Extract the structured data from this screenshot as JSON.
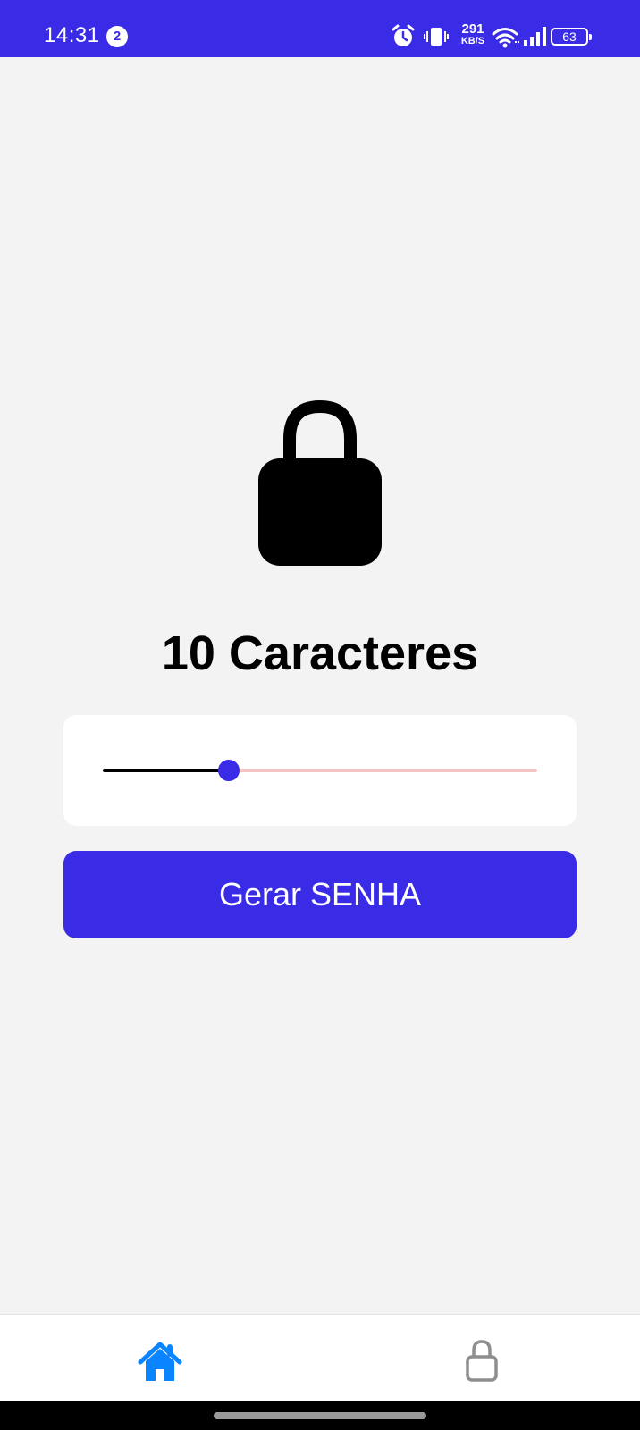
{
  "status_bar": {
    "time": "14:31",
    "notification_count": "2",
    "net_speed_value": "291",
    "net_speed_unit": "KB/S",
    "battery_level": "63",
    "icons": [
      "alarm-icon",
      "vibrate-icon",
      "wifi-icon",
      "signal-icon",
      "battery-icon"
    ],
    "background_color": "#3a2be7"
  },
  "main": {
    "lock_icon": "lock-icon",
    "title": "10 Caracteres",
    "slider": {
      "value_fraction": 0.29,
      "fill_color": "#000000",
      "track_color": "#f7c4c6",
      "thumb_color": "#3a2be7"
    },
    "generate_button_label": "Gerar SENHA",
    "accent_color": "#3a2be7"
  },
  "tab_bar": {
    "tabs": [
      {
        "icon": "home-icon",
        "active": true,
        "color": "#0a84ff"
      },
      {
        "icon": "lock-outline-icon",
        "active": false,
        "color": "#8e8e8e"
      }
    ]
  }
}
